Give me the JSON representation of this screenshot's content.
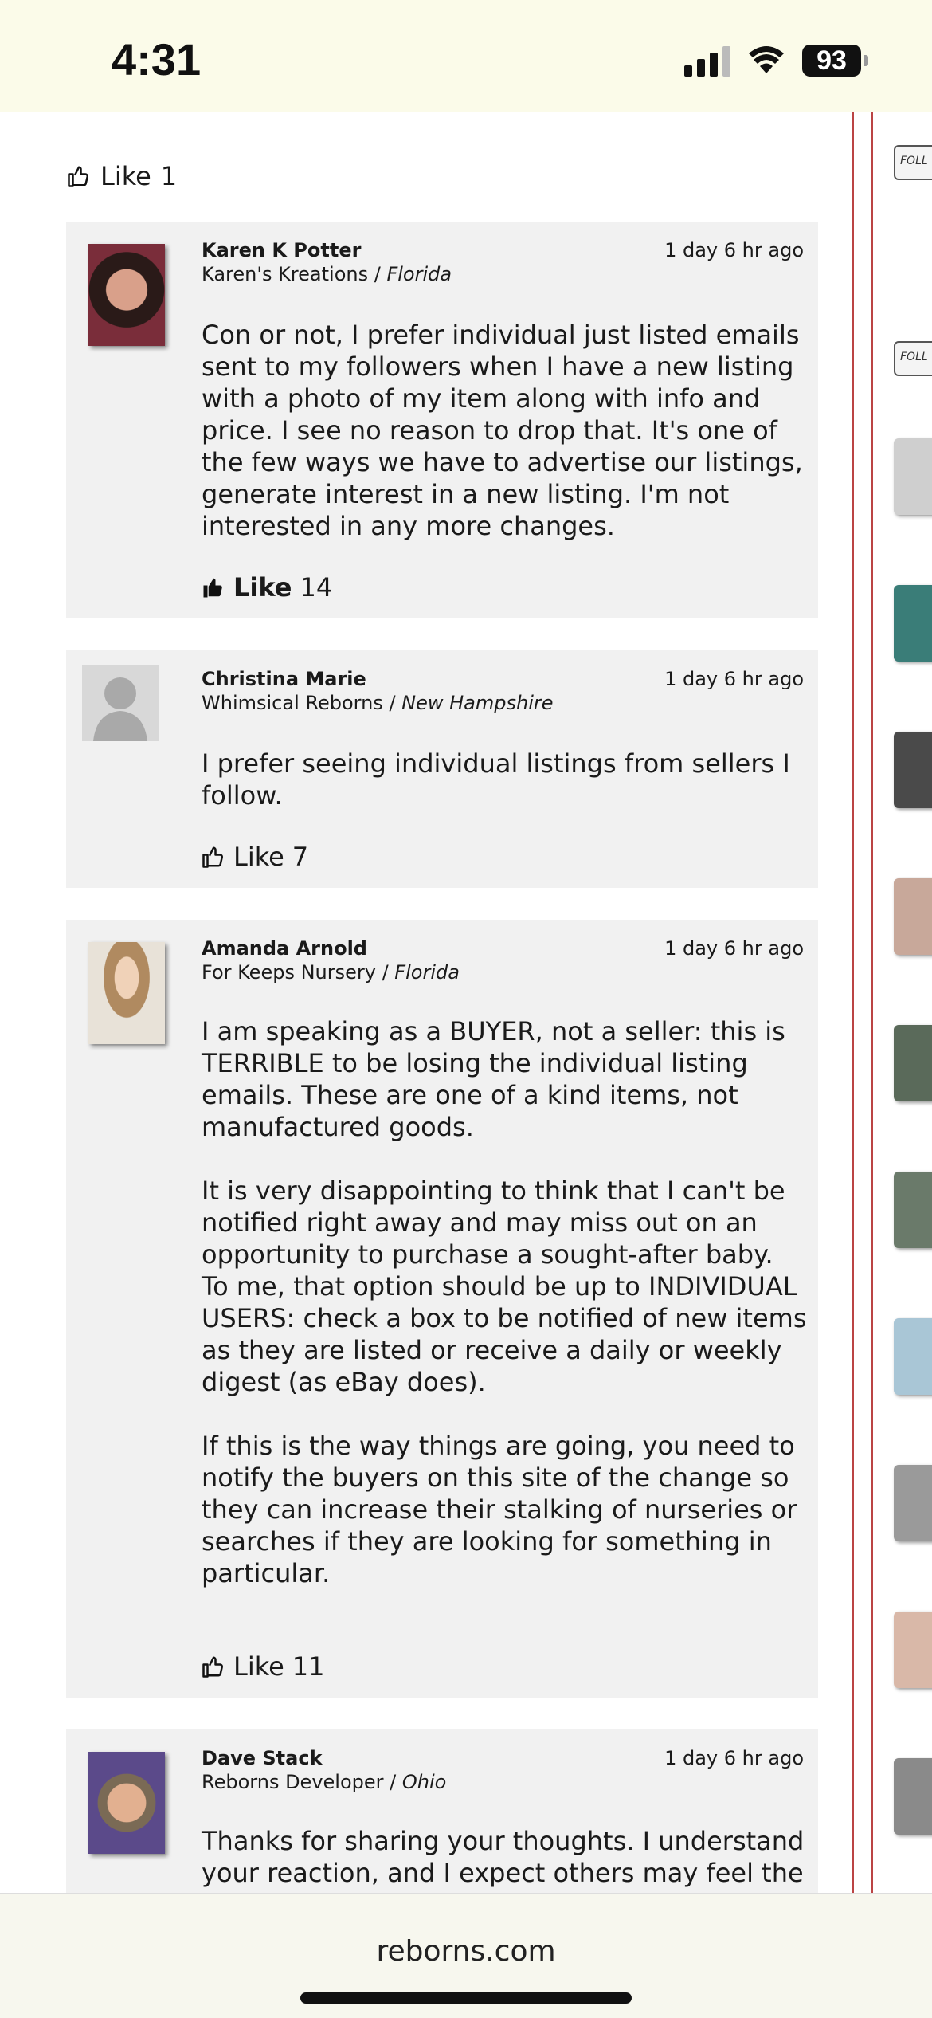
{
  "status_bar": {
    "time": "4:31",
    "battery": "93"
  },
  "page_like": {
    "label": "Like",
    "count": "1"
  },
  "comments": [
    {
      "name": "Karen K Potter",
      "nursery": "Karen's Kreations",
      "location": "Florida",
      "time": "1 day 6 hr ago",
      "paragraphs": [
        "Con or not, I prefer individual just listed emails sent to my followers when I have a new listing with a photo of my item along with info and price. I see no reason to drop that. It's one of the few ways we have to advertise our listings, generate interest in a new listing. I'm not interested in any more changes."
      ],
      "like_label": "Like",
      "like_count": "14",
      "liked": true
    },
    {
      "name": "Christina Marie",
      "nursery": "Whimsical Reborns",
      "location": "New Hampshire",
      "time": "1 day 6 hr ago",
      "paragraphs": [
        "I prefer seeing individual listings from sellers I follow."
      ],
      "like_label": "Like",
      "like_count": "7",
      "liked": false
    },
    {
      "name": "Amanda Arnold",
      "nursery": "For Keeps Nursery",
      "location": "Florida",
      "time": "1 day 6 hr ago",
      "paragraphs": [
        "I am speaking as a BUYER, not a seller: this is TERRIBLE to be losing the individual listing emails. These are one of a kind items, not manufactured goods.",
        "It is very disappointing to think that I can't be notified right away and may miss out on an opportunity to purchase a sought-after baby. To me, that option should be up to INDIVIDUAL USERS: check a box to be notified of new items as they are listed or receive a daily or weekly digest (as eBay does).",
        "If this is the way things are going, you need to notify the buyers on this site of the change so they can increase their stalking of nurseries or searches if they are looking for something in particular."
      ],
      "like_label": "Like",
      "like_count": "11",
      "liked": false
    },
    {
      "name": "Dave Stack",
      "nursery": "Reborns Developer",
      "location": "Ohio",
      "time": "1 day 6 hr ago",
      "paragraphs": [
        "Thanks for sharing your thoughts. I understand your reaction, and I expect others may feel the same. Change is never easy, especially when it"
      ]
    }
  ],
  "sidebar": {
    "follow_banner": "FOLL"
  },
  "browser": {
    "url": "reborns.com"
  }
}
